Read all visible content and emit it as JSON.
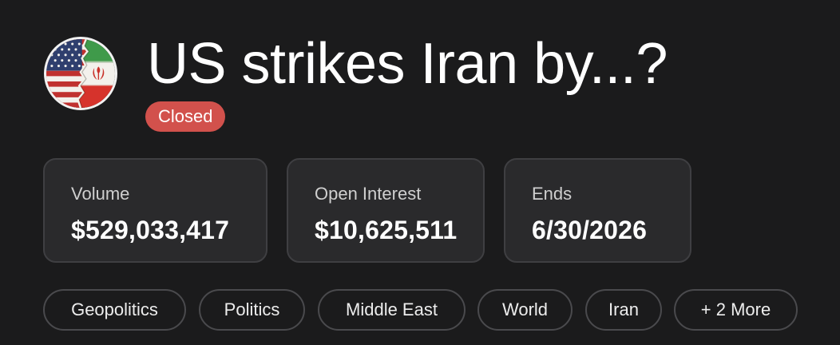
{
  "market": {
    "title": "US strikes Iran by...?",
    "status": "Closed",
    "avatar_icon": "us-iran-flags-icon",
    "colors": {
      "status_badge": "#d2514c",
      "background": "#1b1b1c",
      "card": "#2a2a2c"
    }
  },
  "stats": [
    {
      "label": "Volume",
      "value": "$529,033,417"
    },
    {
      "label": "Open Interest",
      "value": "$10,625,511"
    },
    {
      "label": "Ends",
      "value": "6/30/2026"
    }
  ],
  "tags": [
    "Geopolitics",
    "Politics",
    "Middle East",
    "World",
    "Iran",
    "+ 2 More"
  ]
}
